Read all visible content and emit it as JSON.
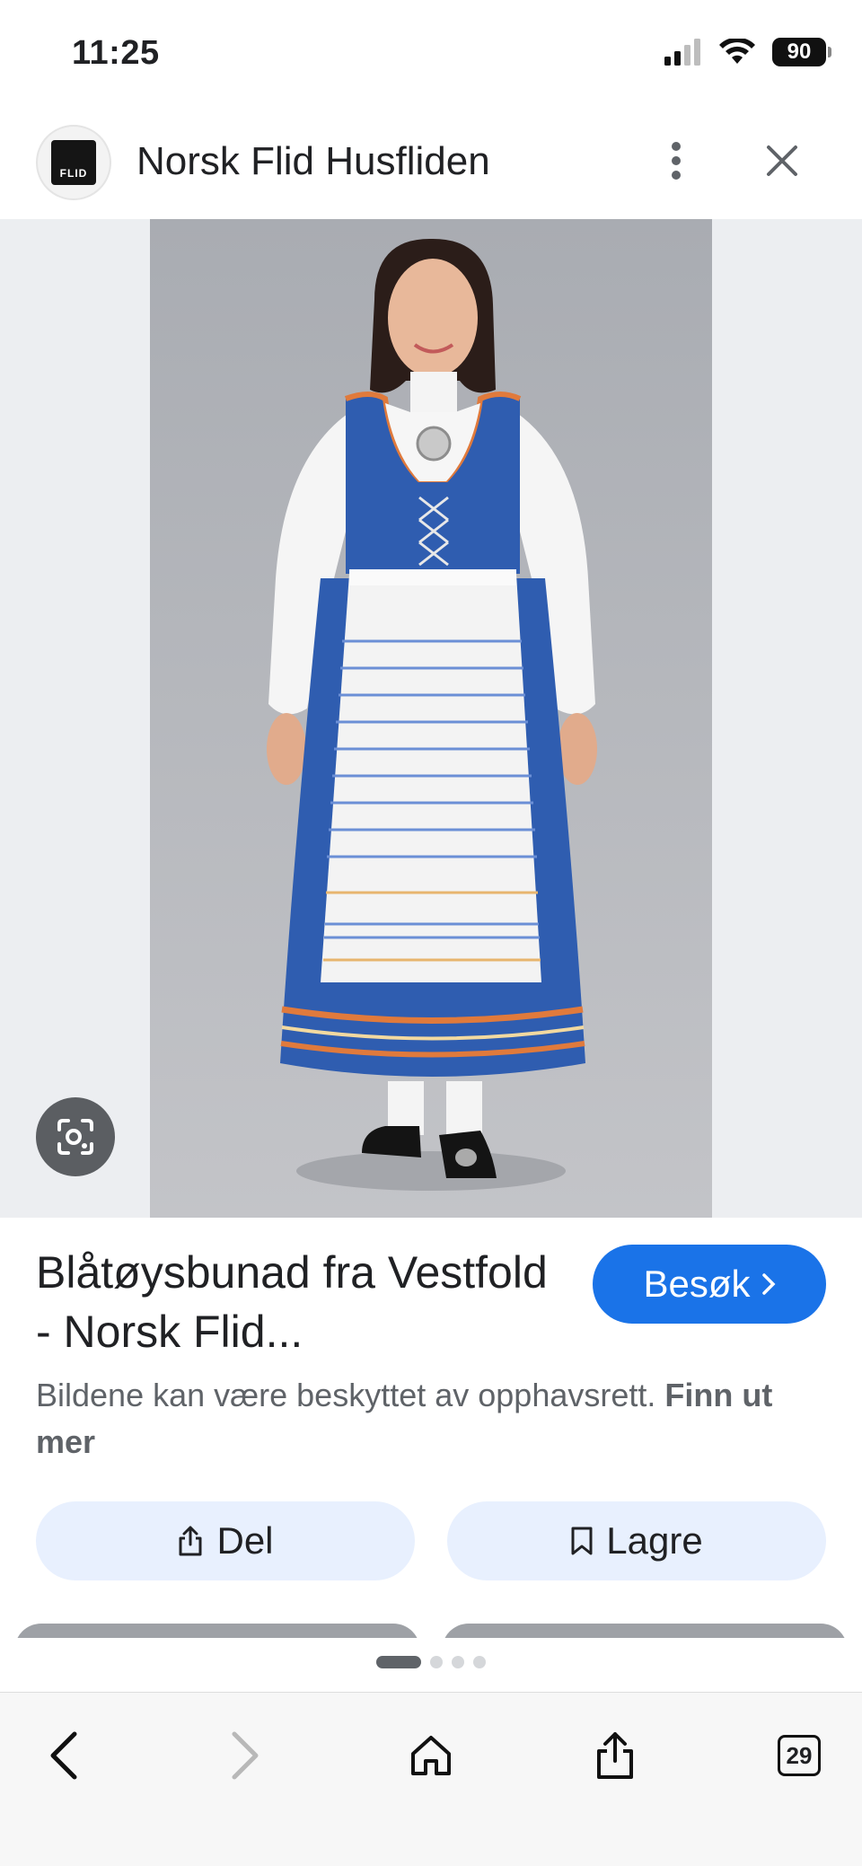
{
  "status_bar": {
    "time": "11:25",
    "battery": "90",
    "icons": [
      "signal-icon",
      "wifi-icon",
      "battery-icon"
    ]
  },
  "header": {
    "site_name": "Norsk Flid Husfliden",
    "logo_text": "FLID",
    "icons": [
      "more-vertical-icon",
      "close-icon"
    ]
  },
  "image": {
    "alt_icon": "lens-icon"
  },
  "result": {
    "title": "Blåtøysbunad fra Vestfold - Norsk Flid...",
    "visit_label": "Besøk",
    "copyright_text": "Bildene kan være beskyttet av opphavsrett.",
    "learn_more": "Finn ut mer"
  },
  "actions": {
    "share_label": "Del",
    "save_label": "Lagre"
  },
  "bottom_bar": {
    "tabs_count": "29"
  },
  "colors": {
    "accent": "#1a73e8",
    "pill_bg": "#e8f0fe",
    "costume_blue": "#2f5db0",
    "trim_orange": "#e07a3c"
  }
}
